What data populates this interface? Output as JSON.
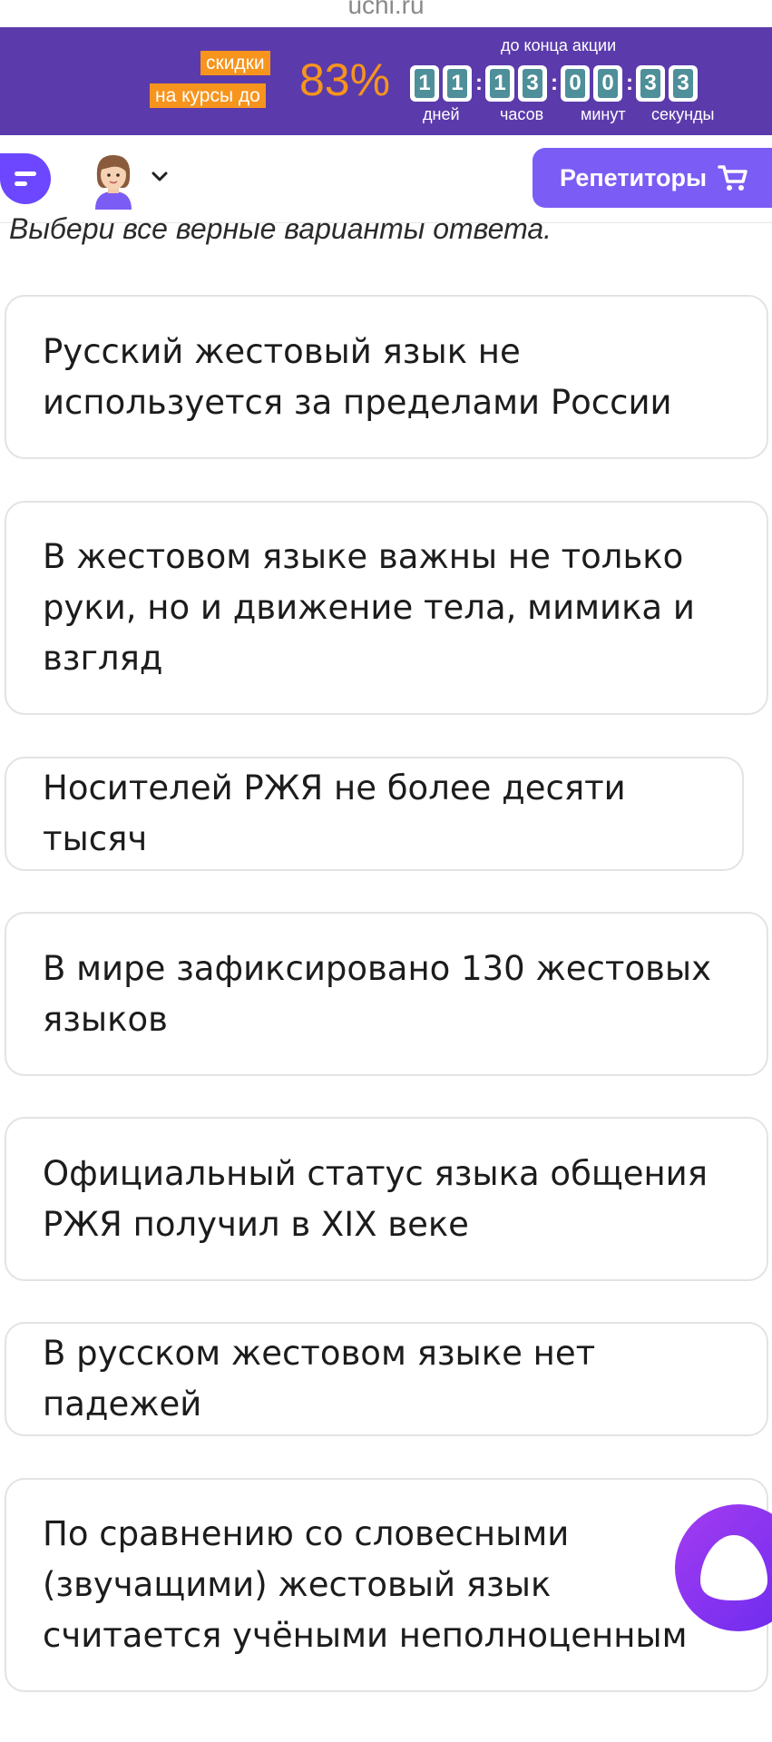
{
  "browser": {
    "url": "uchi.ru"
  },
  "promo": {
    "label_line1": "скидки",
    "label_line2": "на курсы до",
    "percent": "83%",
    "until_text": "до конца акции",
    "countdown": {
      "days": [
        "1",
        "1"
      ],
      "hours": [
        "1",
        "3"
      ],
      "minutes": [
        "0",
        "0"
      ],
      "seconds": [
        "3",
        "3"
      ],
      "days_label": "дней",
      "hours_label": "часов",
      "minutes_label": "минут",
      "seconds_label": "секунды"
    },
    "colors": {
      "background": "#5b3bab",
      "accent": "#f7941d"
    }
  },
  "header": {
    "chat_icon": "chat-bubble-icon",
    "avatar_icon": "teacher-avatar",
    "dropdown_icon": "chevron-down-icon",
    "tutors_label": "Репетиторы",
    "cart_icon": "cart-icon",
    "accent": "#7b5cf5"
  },
  "task": {
    "instruction": "Выбери все верные варианты ответа.",
    "options": [
      {
        "text": "Русский жестовый язык не используется за пределами России"
      },
      {
        "text": "В жестовом языке важны не только руки, но и движение тела, мимика и взгляд"
      },
      {
        "text": "Носителей РЖЯ не более десяти тысяч"
      },
      {
        "text": "В мире зафиксировано 130 жестовых языков"
      },
      {
        "text": "Официальный статус языка общения РЖЯ получил в XIX веке"
      },
      {
        "text": "В русском жестовом языке нет падежей"
      },
      {
        "text": "По сравнению со словесными (звучащими) жестовый язык считается учёными неполноценным"
      }
    ]
  },
  "assistant": {
    "icon": "alice-assistant-icon",
    "color": "#8a35f0"
  }
}
